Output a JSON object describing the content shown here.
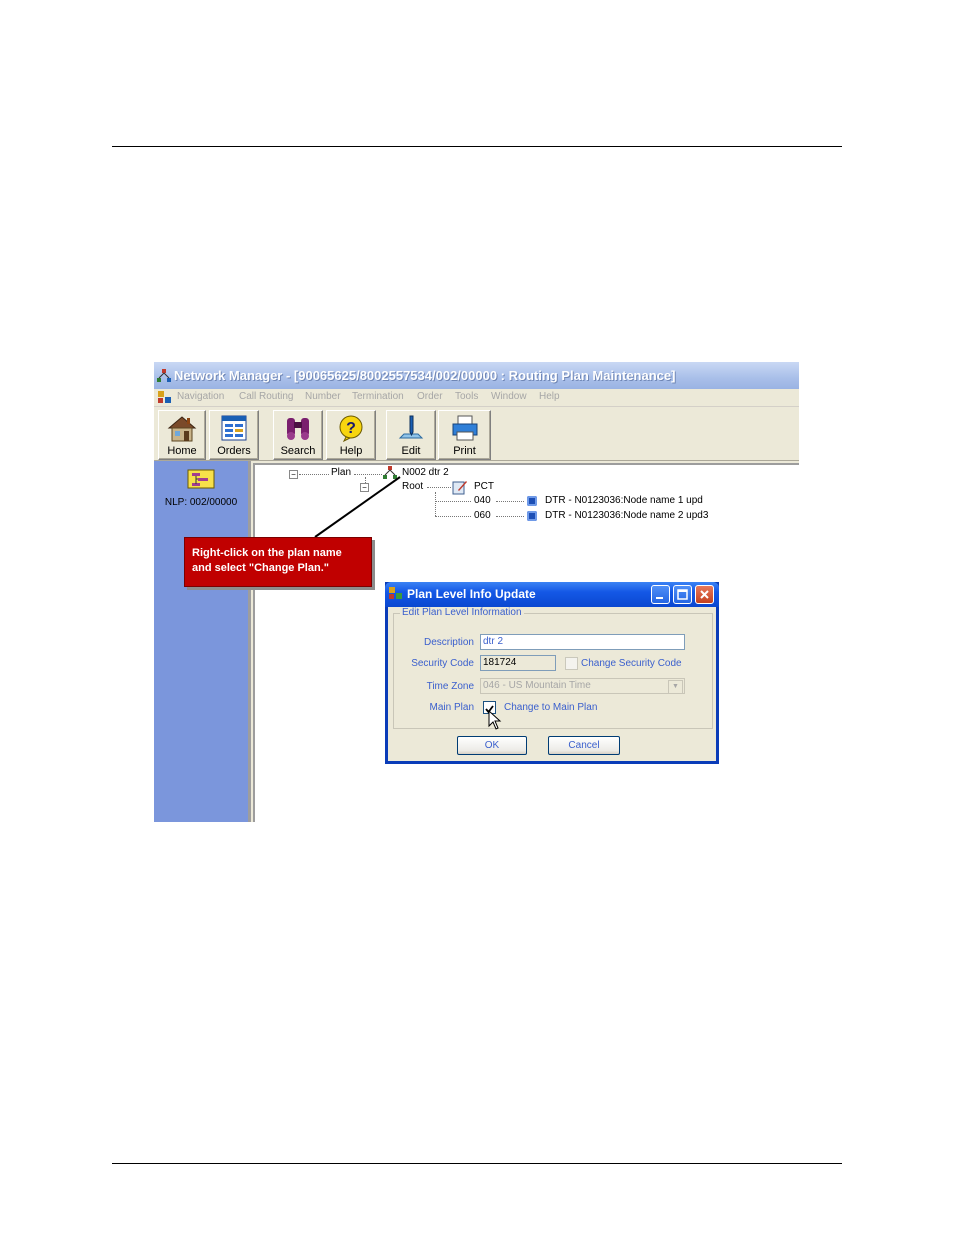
{
  "window": {
    "title": "Network Manager - [90065625/8002557534/002/00000 : Routing Plan Maintenance]"
  },
  "menu": [
    "Navigation",
    "Call Routing",
    "Number",
    "Termination",
    "Order",
    "Tools",
    "Window",
    "Help"
  ],
  "toolbar": {
    "home": "Home",
    "orders": "Orders",
    "search": "Search",
    "help": "Help",
    "edit": "Edit",
    "print": "Print"
  },
  "sidebar": {
    "nlp_label": "NLP: 002/00000"
  },
  "tree": {
    "plan_label": "Plan",
    "plan_name": "N002  dtr 2",
    "root_label": "Root",
    "pct_label": "PCT",
    "node1_code": "040",
    "node1_label": "DTR - N0123036:Node name 1 upd",
    "node2_code": "060",
    "node2_label": "DTR - N0123036:Node name 2 upd3"
  },
  "callout": {
    "line1": "Right-click on the plan name",
    "line2": "and select \"Change Plan.\""
  },
  "dialog": {
    "title": "Plan Level Info Update",
    "group_legend": "Edit Plan Level Information",
    "description_label": "Description",
    "description_value": "dtr 2",
    "security_label": "Security Code",
    "security_value": "181724",
    "change_security_label": "Change Security Code",
    "timezone_label": "Time Zone",
    "timezone_value": "046 - US Mountain Time",
    "mainplan_label": "Main Plan",
    "change_main_label": "Change to Main Plan",
    "ok": "OK",
    "cancel": "Cancel"
  },
  "colors": {
    "sidebar": "#7b96dc",
    "callout": "#c00000",
    "dialog_title": "#0a47d0"
  }
}
